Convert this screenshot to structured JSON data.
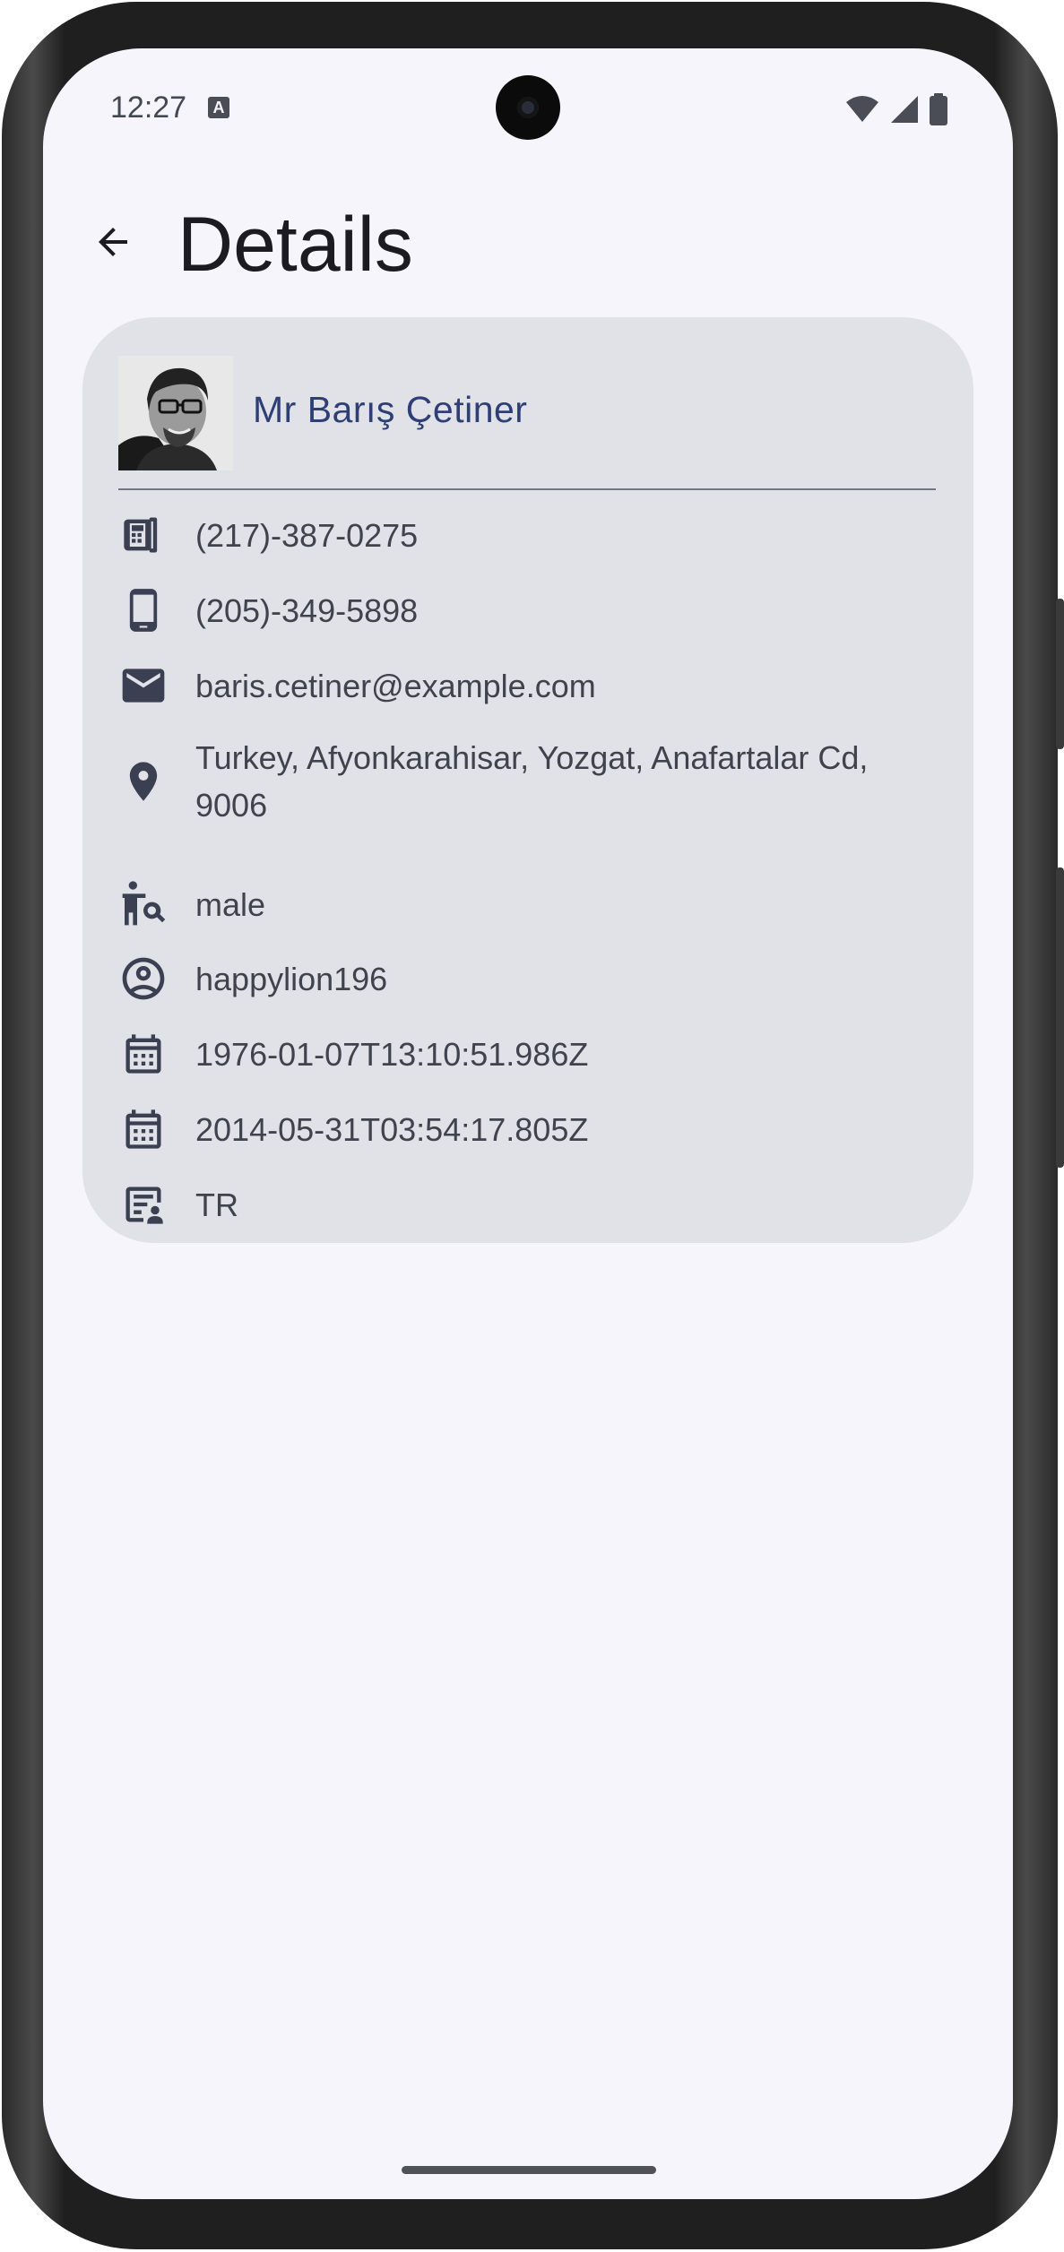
{
  "status_bar": {
    "time": "12:27",
    "notification_icon": "a-icon",
    "notification_glyph": "A",
    "icons": [
      "wifi-icon",
      "signal-icon",
      "battery-icon"
    ]
  },
  "app_bar": {
    "back_icon": "arrow-back-icon",
    "title": "Details"
  },
  "profile": {
    "name": "Mr Barış Çetiner",
    "avatar": "avatar-photo",
    "fields": [
      {
        "icon": "phone-office-icon",
        "value": "(217)-387-0275"
      },
      {
        "icon": "mobile-phone-icon",
        "value": "(205)-349-5898"
      },
      {
        "icon": "mail-icon",
        "value": "baris.cetiner@example.com"
      },
      {
        "icon": "location-pin-icon",
        "value": "Turkey, Afyonkarahisar, Yozgat, Anafartalar Cd, 9006"
      },
      {
        "icon": "gender-search-icon",
        "value": "male"
      },
      {
        "icon": "account-circle-icon",
        "value": "happylion196"
      },
      {
        "icon": "calendar-icon",
        "value": "1976-01-07T13:10:51.986Z"
      },
      {
        "icon": "calendar-icon",
        "value": "2014-05-31T03:54:17.805Z"
      },
      {
        "icon": "id-card-icon",
        "value": "TR"
      }
    ]
  },
  "colors": {
    "background": "#f6f5fc",
    "card": "#e1e1e8",
    "name": "#2e3f75",
    "text": "#3f434d",
    "icon": "#3a3f52"
  }
}
